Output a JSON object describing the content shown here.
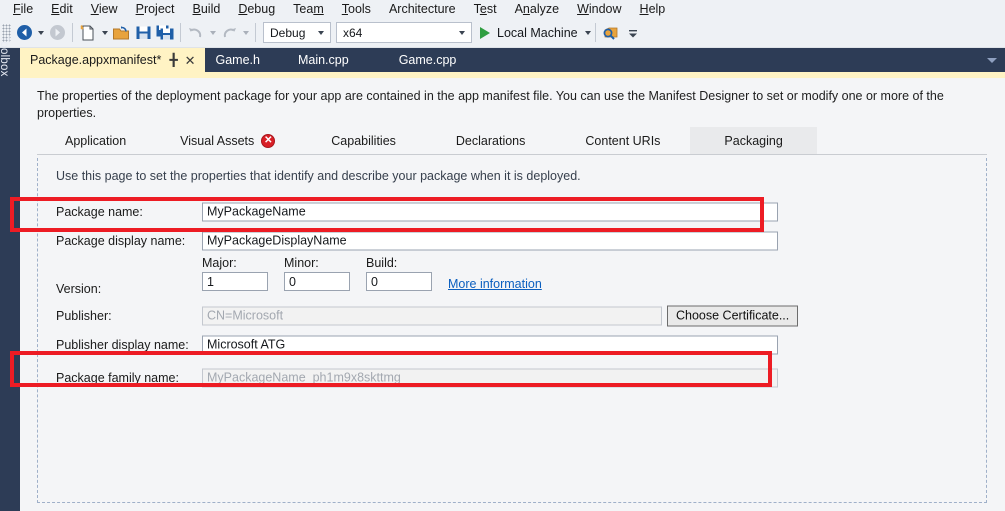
{
  "menubar": {
    "items": [
      {
        "label": "File",
        "accesskey": "F"
      },
      {
        "label": "Edit",
        "accesskey": "E"
      },
      {
        "label": "View",
        "accesskey": "V"
      },
      {
        "label": "Project",
        "accesskey": "P"
      },
      {
        "label": "Build",
        "accesskey": "B"
      },
      {
        "label": "Debug",
        "accesskey": "D"
      },
      {
        "label": "Team",
        "accesskey": "m"
      },
      {
        "label": "Tools",
        "accesskey": "T"
      },
      {
        "label": "Architecture",
        "accesskey": ""
      },
      {
        "label": "Test",
        "accesskey": "e"
      },
      {
        "label": "Analyze",
        "accesskey": "n"
      },
      {
        "label": "Window",
        "accesskey": "W"
      },
      {
        "label": "Help",
        "accesskey": "H"
      }
    ]
  },
  "toolbar": {
    "nav_back_icon": "navigate-back-icon",
    "nav_forward_icon": "navigate-forward-icon",
    "new_item_icon": "new-item-icon",
    "open_file_icon": "open-file-icon",
    "save_icon": "save-icon",
    "save_all_icon": "save-all-icon",
    "undo_icon": "undo-icon",
    "redo_icon": "redo-icon",
    "configuration": "Debug",
    "platform": "x64",
    "run_target": "Local Machine",
    "run_icon": "play-icon",
    "find_icon": "find-in-files-icon",
    "overflow_icon": "toolbar-overflow-icon"
  },
  "toolbox": {
    "label": "Toolbox"
  },
  "document_tabs": {
    "tabs": [
      {
        "label": "Package.appxmanifest*",
        "active": true
      },
      {
        "label": "Game.h",
        "active": false
      },
      {
        "label": "Main.cpp",
        "active": false
      },
      {
        "label": "Game.cpp",
        "active": false
      }
    ],
    "pin_icon": "pin-icon",
    "close_icon": "close-icon",
    "overflow_icon": "tab-overflow-chevron-icon"
  },
  "document": {
    "description": "The properties of the deployment package for your app are contained in the app manifest file. You can use the Manifest Designer to set or modify one or more of the properties."
  },
  "designer_tabs": {
    "tabs": [
      {
        "label": "Application",
        "selected": false,
        "error": false
      },
      {
        "label": "Visual Assets",
        "selected": false,
        "error": true
      },
      {
        "label": "Capabilities",
        "selected": false,
        "error": false
      },
      {
        "label": "Declarations",
        "selected": false,
        "error": false
      },
      {
        "label": "Content URIs",
        "selected": false,
        "error": false
      },
      {
        "label": "Packaging",
        "selected": true,
        "error": false
      }
    ],
    "error_badge_glyph": "✕"
  },
  "packaging": {
    "subtitle": "Use this page to set the properties that identify and describe your package when it is deployed.",
    "package_name": {
      "label": "Package name:",
      "value": "MyPackageName"
    },
    "package_display_name": {
      "label": "Package display name:",
      "value": "MyPackageDisplayName"
    },
    "version": {
      "label": "Version:",
      "major": {
        "caption": "Major:",
        "value": "1"
      },
      "minor": {
        "caption": "Minor:",
        "value": "0"
      },
      "build": {
        "caption": "Build:",
        "value": "0"
      },
      "more_information": "More information"
    },
    "publisher": {
      "label": "Publisher:",
      "value": "CN=Microsoft",
      "button": "Choose Certificate..."
    },
    "publisher_display_name": {
      "label": "Publisher display name:",
      "value": "Microsoft ATG"
    },
    "package_family_name": {
      "label": "Package family name:",
      "value": "MyPackageName_ph1m9x8skttmg"
    }
  },
  "annotations": {
    "highlight_color": "#ed1c24",
    "boxes": [
      "package-name-row",
      "package-family-name-row"
    ]
  },
  "colors": {
    "chrome": "#eef1f5",
    "tabstrip": "#2d3c56",
    "active_tab": "#fff3c4",
    "surface": "#f4f5f7",
    "link": "#0b5fbf",
    "error": "#d91f26",
    "run_green": "#2f9e41"
  }
}
